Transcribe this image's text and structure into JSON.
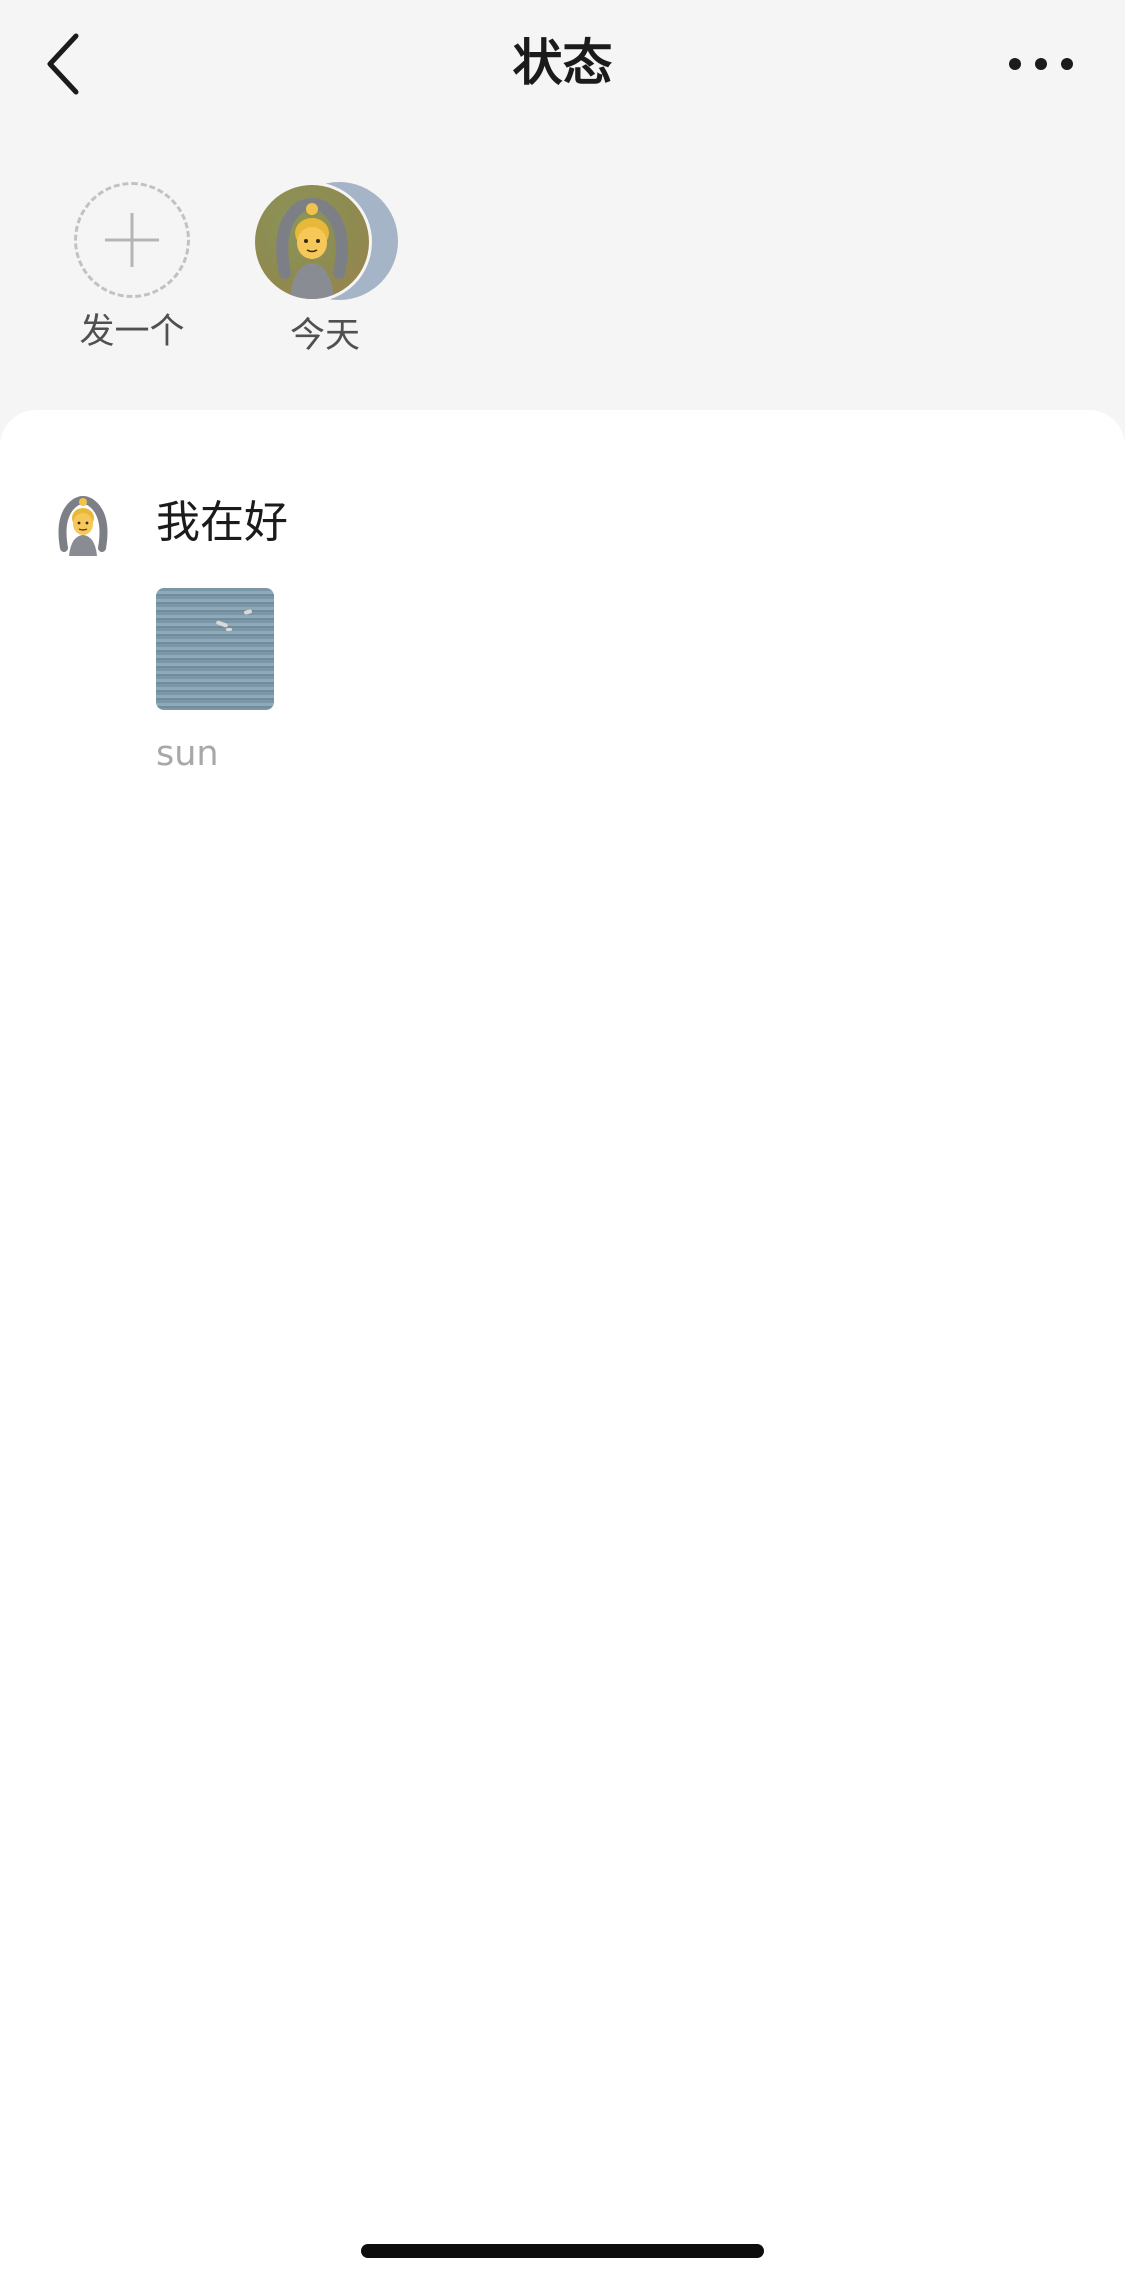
{
  "header": {
    "title": "状态",
    "back_icon": "chevron-left-icon",
    "more_icon": "more-horizontal-icon"
  },
  "status_strip": {
    "items": [
      {
        "label": "发一个",
        "icon": "add-icon"
      },
      {
        "label": "今天",
        "icon": "person-gesturing-ok-emoji"
      }
    ]
  },
  "feed": {
    "posts": [
      {
        "avatar": "person-gesturing-ok-emoji",
        "text": "我在好",
        "image": "sea-with-gulls-thumbnail",
        "caption": "sun"
      }
    ]
  },
  "colors": {
    "background": "#f5f5f5",
    "card": "#ffffff",
    "text": "#1b1b1b",
    "muted": "#a8a8a8"
  }
}
